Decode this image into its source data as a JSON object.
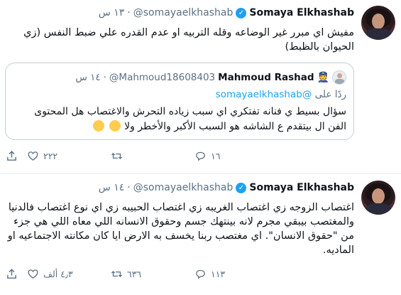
{
  "tweets": [
    {
      "author_name": "Somaya Elkhashab",
      "handle": "@somayaelkhashab",
      "time": "١٣ س",
      "text": "مفيش اي مبرر غير الوضاعه وقله التربيه او عدم القدره علي ضبط النفس (زي الحيوان بالظبط)",
      "quoted": {
        "author_name": "Mahmoud Rashad",
        "handle": "@Mahmoud18608403",
        "time": "١٤ س",
        "reply_prefix": "ردًا على",
        "reply_handle": "@somayaelkhashab",
        "text": "سؤال بسيط ي فنانه تفتكري اي سبب زياده التحرش والاغتصاب هل المحتوى الفن ال بيتقدم ع الشاشه هو السبب الأكبر والأخطر ولا"
      },
      "actions": {
        "reply_count": "١٦",
        "retweet_count": "",
        "like_count": "٢٢٢"
      }
    },
    {
      "author_name": "Somaya Elkhashab",
      "handle": "@somayaelkhashab",
      "time": "١٤ س",
      "text": "اغتصاب الزوجه زي اغتصاب الغريبه زي اغتصاب الحبيبه زي اي نوع اغتصاب فالدنيا والمغتصب بيبقي مجرم لانه بينتهك جسم وحقوق الانسانه اللي معاه اللي هي جزء من \"حقوق الانسان\". اي مغتصب ربنا يخسف به الارض ايا كان مكانته الاجتماعيه او الماديه.",
      "actions": {
        "reply_count": "١١٣",
        "retweet_count": "٦٣٦",
        "like_count": "٤٫٣ ألف"
      }
    }
  ],
  "icons": {
    "verified": "verified-badge-icon",
    "reply": "reply-icon",
    "retweet": "retweet-icon",
    "like": "heart-icon",
    "share": "share-icon"
  },
  "colors": {
    "accent": "#1da1f2",
    "muted": "#5b7083",
    "border": "#c4cfd6"
  }
}
